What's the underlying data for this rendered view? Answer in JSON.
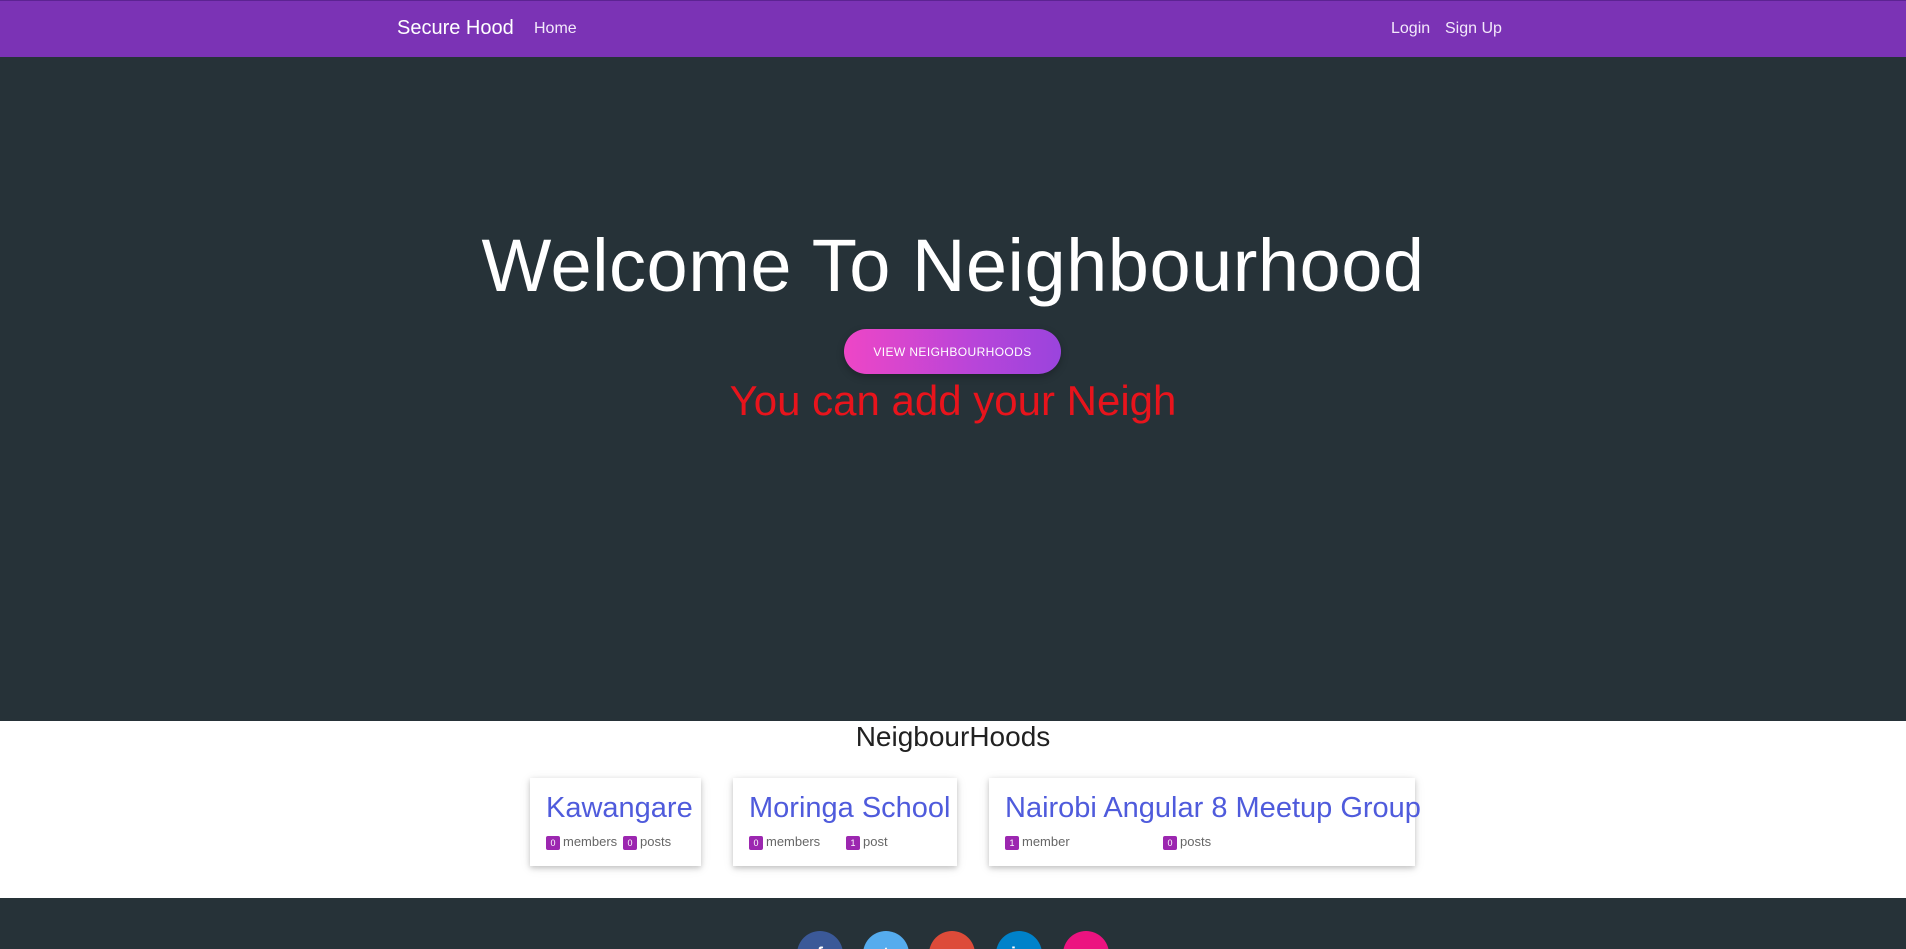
{
  "navbar": {
    "brand": "Secure Hood",
    "home": "Home",
    "login": "Login",
    "signup": "Sign Up"
  },
  "hero": {
    "title": "Welcome To Neighbourhood",
    "button": "VIEW NEIGHBOURHOODS",
    "subtitle": "You can add your Neigh"
  },
  "section": {
    "title": "NeigbourHoods"
  },
  "cards": [
    {
      "name": "Kawangare",
      "members_count": "0",
      "members_label": "members",
      "posts_count": "0",
      "posts_label": "posts"
    },
    {
      "name": "Moringa School",
      "members_count": "0",
      "members_label": "members",
      "posts_count": "1",
      "posts_label": "post"
    },
    {
      "name": "Nairobi Angular 8 Meetup Group",
      "members_count": "1",
      "members_label": "member",
      "posts_count": "0",
      "posts_label": "posts"
    }
  ],
  "footer": {
    "social": [
      {
        "icon": "facebook-icon",
        "glyph": "f",
        "color": "#3b5998"
      },
      {
        "icon": "twitter-icon",
        "glyph": "t",
        "color": "#55acee"
      },
      {
        "icon": "google-plus-icon",
        "glyph": "g",
        "color": "#dd4b39"
      },
      {
        "icon": "linkedin-icon",
        "glyph": "in",
        "color": "#0082ca"
      },
      {
        "icon": "pinterest-icon",
        "glyph": "p",
        "color": "#ec1380"
      }
    ]
  },
  "colors": {
    "navbar": "#7b33b5",
    "hero_bg": "#263238",
    "accent_link": "#4f5bdc",
    "badge": "#9c27b0",
    "subtitle_red": "#e8141c"
  }
}
